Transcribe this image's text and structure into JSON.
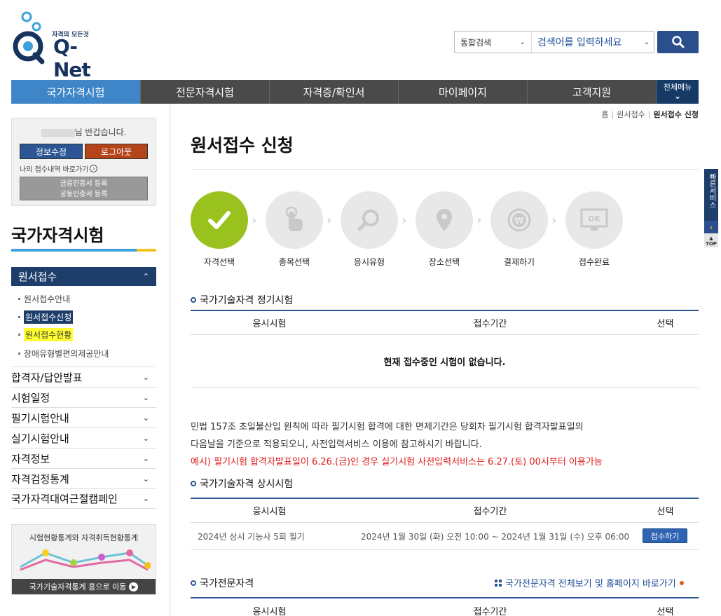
{
  "header": {
    "logo_tagline": "자격의 모든것",
    "logo_text": "Q-Net",
    "search_scope": "통합검색",
    "search_placeholder": "검색어를 입력하세요"
  },
  "gnb": {
    "tabs": [
      "국가자격시험",
      "전문자격시험",
      "자격증/확인서",
      "마이페이지",
      "고객지원"
    ],
    "all_menu": "전체메뉴"
  },
  "user": {
    "greeting": "님 반갑습니다.",
    "edit_label": "정보수정",
    "logout_label": "로그아웃",
    "my_application_link": "나의 접수내역 바로가기",
    "cert_line1": "금융인증서 등록",
    "cert_line2": "공동인증서 등록"
  },
  "lnb": {
    "title": "국가자격시험",
    "open_menu": "원서접수",
    "sub_items": [
      "원서접수안내",
      "원서접수신청",
      "원서접수현황",
      "장애유형별편의제공안내"
    ],
    "menus": [
      "합격자/답안발표",
      "시험일정",
      "필기시험안내",
      "실기시험안내",
      "자격정보",
      "자격검정통계",
      "국가자격대여근절캠페인"
    ]
  },
  "stat_box": {
    "title": "시험현황통계와 자격취득현황통계",
    "link": "국가기술자격통계 홈으로 이동"
  },
  "breadcrumb": [
    "홈",
    "원서접수",
    "원서접수 신청"
  ],
  "page_title": "원서접수 신청",
  "steps": [
    "자격선택",
    "종목선택",
    "응시유형",
    "장소선택",
    "결제하기",
    "접수완료"
  ],
  "section_regular": {
    "title": "국가기술자격 정기시험",
    "headers": [
      "응시시험",
      "접수기간",
      "선택"
    ],
    "empty_message": "현재 접수중인 시험이 없습니다."
  },
  "notice": {
    "line1": "민법 157조 초일불산입 원칙에 따라 필기시험 합격에 대한 면제기간은 당회차 필기시험 합격자발표일의",
    "line2": "다음날을 기준으로 적용되오니, 사전입력서비스 이용에 참고하시기 바랍니다.",
    "line3": "예시) 필기시험 합격자발표일이 6.26.(금)인 경우 실기시험 사전입력서비스는 6.27.(토) 00시부터 이용가능"
  },
  "section_anytime": {
    "title": "국가기술자격 상시시험",
    "headers": [
      "응시시험",
      "접수기간",
      "선택"
    ],
    "rows": [
      {
        "exam": "2024년 상시 기능사 5회 필기",
        "period": "2024년 1월 30일 (화) 오전 10:00 ~ 2024년 1월 31일 (수) 오후 06:00",
        "action": "접수하기"
      }
    ]
  },
  "section_pro": {
    "title": "국가전문자격",
    "link": "국가전문자격 전체보기 및 홈페이지 바로가기",
    "headers": [
      "응시시험",
      "접수기간",
      "선택"
    ]
  },
  "quick": {
    "label": "빠른서비스",
    "top": "TOP"
  },
  "colors": {
    "brand_navy": "#1d3e6b",
    "accent_blue": "#3e86c8",
    "step_active": "#9ac21f",
    "warning_red": "#e01b1b"
  }
}
